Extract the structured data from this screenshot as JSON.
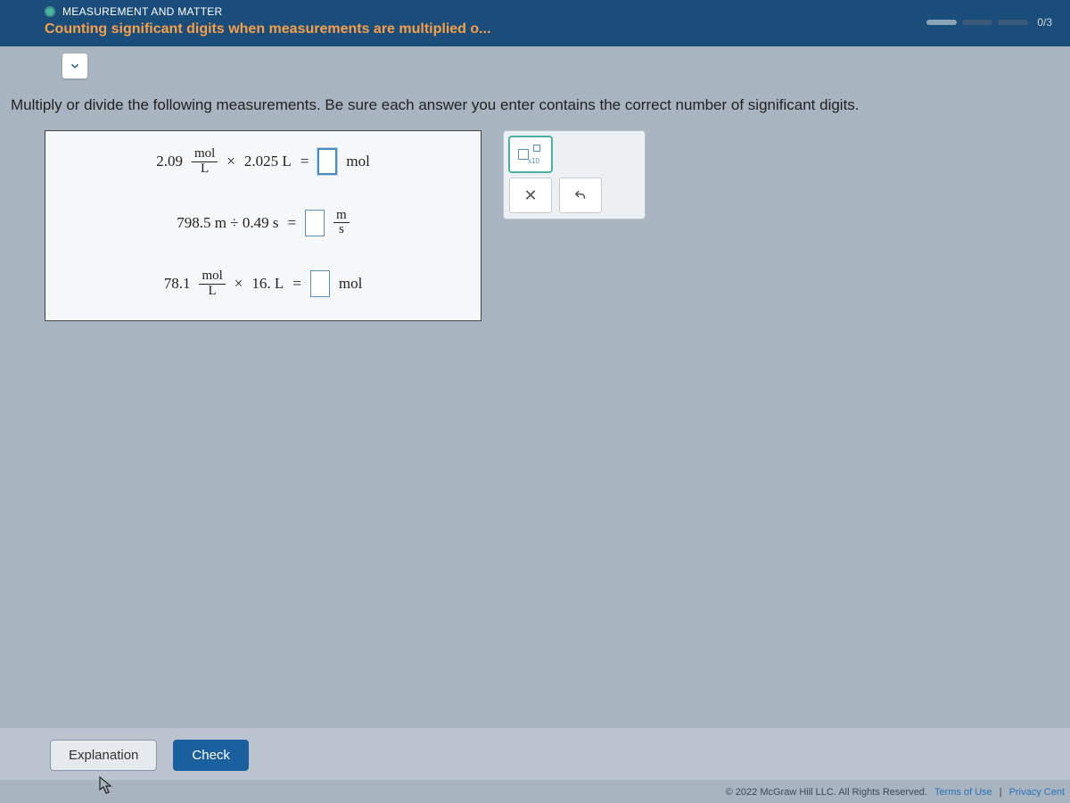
{
  "header": {
    "category": "MEASUREMENT AND MATTER",
    "title": "Counting significant digits when measurements are multiplied o...",
    "progress_label": "0/3"
  },
  "instructions": "Multiply or divide the following measurements. Be sure each answer you enter contains the correct number of significant digits.",
  "equations": [
    {
      "lhs_prefix": "2.09",
      "frac_num": "mol",
      "frac_den": "L",
      "op": "×",
      "rhs_value": "2.025 L",
      "equals": "=",
      "unit_after_box": "mol",
      "box_active": true
    },
    {
      "lhs_text": "798.5 m ÷ 0.49 s",
      "equals": "=",
      "result_frac_num": "m",
      "result_frac_den": "s"
    },
    {
      "lhs_prefix": "78.1",
      "frac_num": "mol",
      "frac_den": "L",
      "op": "×",
      "rhs_value": "16. L",
      "equals": "=",
      "unit_after_box": "mol"
    }
  ],
  "keypad": {
    "sci_label": "x10",
    "clear_label": "×",
    "undo_label": "↶"
  },
  "footer": {
    "explanation_label": "Explanation",
    "check_label": "Check"
  },
  "legal": {
    "copyright": "© 2022 McGraw Hill LLC. All Rights Reserved.",
    "terms": "Terms of Use",
    "divider": "|",
    "privacy": "Privacy Cent"
  }
}
